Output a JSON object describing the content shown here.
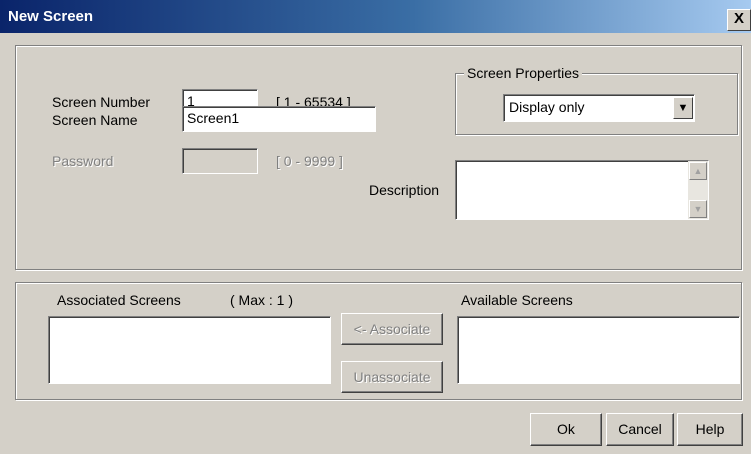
{
  "window": {
    "title": "New Screen",
    "close_glyph": "X"
  },
  "form": {
    "screen_number": {
      "label": "Screen  Number",
      "value": "1",
      "range": "[ 1 - 65534 ]"
    },
    "screen_name": {
      "label": "Screen  Name",
      "value": "Screen1"
    },
    "password": {
      "label": "Password",
      "value": "",
      "range": "[ 0 - 9999 ]"
    },
    "description": {
      "label": "Description",
      "value": ""
    }
  },
  "screen_properties": {
    "legend": "Screen Properties",
    "selected": "Display only"
  },
  "associated": {
    "label": "Associated Screens",
    "max": "( Max : 1 )"
  },
  "available": {
    "label": "Available Screens"
  },
  "buttons": {
    "associate": "<- Associate",
    "unassociate": "Unassociate",
    "ok": "Ok",
    "cancel": "Cancel",
    "help": "Help"
  },
  "icons": {
    "close": "close-icon",
    "dropdown": "chevron-down-icon",
    "scroll_up": "scroll-up-icon",
    "scroll_down": "scroll-down-icon"
  }
}
